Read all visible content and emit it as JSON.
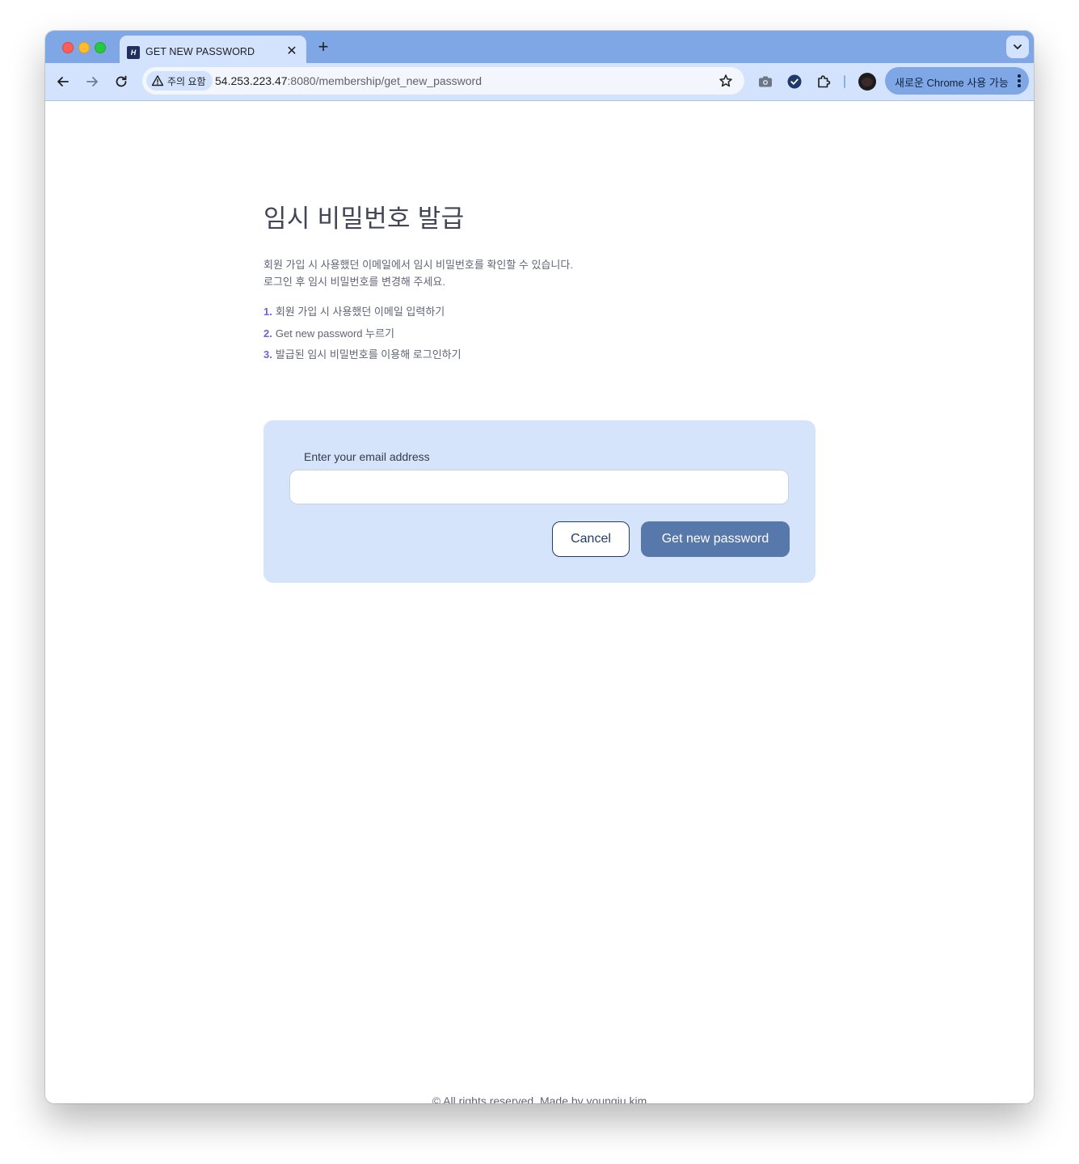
{
  "browser": {
    "tab": {
      "favicon_text": "H",
      "title": "GET NEW PASSWORD",
      "close": "✕"
    },
    "new_tab": "+",
    "security_chip": "주의 요함",
    "url": {
      "host": "54.253.223.47",
      "rest": ":8080/membership/get_new_password"
    },
    "chrome_pill": "새로운 Chrome 사용 가능",
    "colors": {
      "tabstrip": "#7fa6e5",
      "toolbar": "#d3e3fd"
    }
  },
  "page": {
    "title": "임시 비밀번호 발급",
    "description": [
      "회원 가입 시 사용했던 이메일에서 임시 비밀번호를 확인할 수 있습니다.",
      "로그인 후 임시 비밀번호를 변경해 주세요."
    ],
    "steps": [
      {
        "num": "1.",
        "text": "회원 가입 시 사용했던 이메일 입력하기"
      },
      {
        "num": "2.",
        "text": "Get new password 누르기"
      },
      {
        "num": "3.",
        "text": "발급된 임시 비밀번호를 이용해 로그인하기"
      }
    ],
    "form": {
      "email_label": "Enter your email address",
      "email_value": "",
      "email_placeholder": "",
      "cancel_label": "Cancel",
      "submit_label": "Get new password"
    },
    "footer": "© All rights reserved. Made by youngju kim",
    "colors": {
      "card": "#d5e4fa",
      "primary_button": "#5778aa",
      "step_number": "#6b63d6"
    }
  }
}
